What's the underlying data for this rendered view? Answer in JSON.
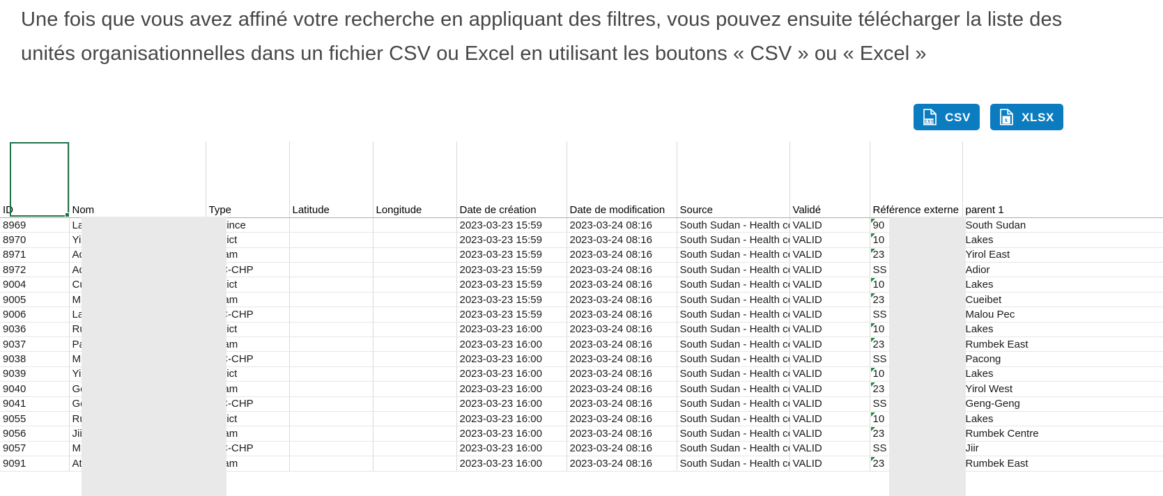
{
  "intro": {
    "text": "Une fois que vous avez affiné votre recherche en appliquant des filtres, vous pouvez ensuite télécharger la liste des unités organisationnelles dans un fichier CSV ou Excel en utilisant les boutons « CSV » ou « Excel »"
  },
  "toolbar": {
    "csv_label": "CSV",
    "xlsx_label": "XLSX",
    "csv_icon": "csv-file-icon",
    "xlsx_icon": "xlsx-file-icon",
    "button_color": "#0c7cc0",
    "button_text_color": "#ffffff"
  },
  "spreadsheet": {
    "active_cell_color": "#217346",
    "headers": [
      "ID",
      "Nom",
      "Type",
      "Latitude",
      "Longitude",
      "Date de création",
      "Date de modification",
      "Source",
      "Validé",
      "Référence externe",
      "parent 1"
    ],
    "rows": [
      {
        "id": "8969",
        "nom": "La",
        "type": "Province",
        "latitude": "",
        "longitude": "",
        "created": "2023-03-23 15:59",
        "modified": "2023-03-24 08:16",
        "source": "South Sudan - Health cen",
        "valide": "VALID",
        "ref": "90",
        "ref_error": true,
        "parent1": "South Sudan"
      },
      {
        "id": "8970",
        "nom": "Yi",
        "type": "District",
        "latitude": "",
        "longitude": "",
        "created": "2023-03-23 15:59",
        "modified": "2023-03-24 08:16",
        "source": "South Sudan - Health cen",
        "valide": "VALID",
        "ref": "10",
        "ref_error": true,
        "parent1": "Lakes"
      },
      {
        "id": "8971",
        "nom": "Ad",
        "type": "Payam",
        "latitude": "",
        "longitude": "",
        "created": "2023-03-23 15:59",
        "modified": "2023-03-24 08:16",
        "source": "South Sudan - Health cen",
        "valide": "VALID",
        "ref": "23",
        "ref_error": true,
        "parent1": "Yirol East"
      },
      {
        "id": "8972",
        "nom": "Ad",
        "type": "CHC-CHP",
        "latitude": "",
        "longitude": "",
        "created": "2023-03-23 15:59",
        "modified": "2023-03-24 08:16",
        "source": "South Sudan - Health cen",
        "valide": "VALID",
        "ref": "SS",
        "ref_error": false,
        "parent1": "Adior"
      },
      {
        "id": "9004",
        "nom": "Cu",
        "type": "District",
        "latitude": "",
        "longitude": "",
        "created": "2023-03-23 15:59",
        "modified": "2023-03-24 08:16",
        "source": "South Sudan - Health cen",
        "valide": "VALID",
        "ref": "10",
        "ref_error": true,
        "parent1": "Lakes"
      },
      {
        "id": "9005",
        "nom": "M",
        "type": "Payam",
        "latitude": "",
        "longitude": "",
        "created": "2023-03-23 15:59",
        "modified": "2023-03-24 08:16",
        "source": "South Sudan - Health cen",
        "valide": "VALID",
        "ref": "23",
        "ref_error": true,
        "parent1": "Cueibet"
      },
      {
        "id": "9006",
        "nom": "La",
        "type": "CHC-CHP",
        "latitude": "",
        "longitude": "",
        "created": "2023-03-23 15:59",
        "modified": "2023-03-24 08:16",
        "source": "South Sudan - Health cen",
        "valide": "VALID",
        "ref": "SS",
        "ref_error": false,
        "parent1": "Malou Pec"
      },
      {
        "id": "9036",
        "nom": "Ru",
        "type": "District",
        "latitude": "",
        "longitude": "",
        "created": "2023-03-23 16:00",
        "modified": "2023-03-24 08:16",
        "source": "South Sudan - Health cen",
        "valide": "VALID",
        "ref": "10",
        "ref_error": true,
        "parent1": "Lakes"
      },
      {
        "id": "9037",
        "nom": "Pa",
        "type": "Payam",
        "latitude": "",
        "longitude": "",
        "created": "2023-03-23 16:00",
        "modified": "2023-03-24 08:16",
        "source": "South Sudan - Health cen",
        "valide": "VALID",
        "ref": "23",
        "ref_error": true,
        "parent1": "Rumbek East"
      },
      {
        "id": "9038",
        "nom": "M",
        "type": "CHC-CHP",
        "latitude": "",
        "longitude": "",
        "created": "2023-03-23 16:00",
        "modified": "2023-03-24 08:16",
        "source": "South Sudan - Health cen",
        "valide": "VALID",
        "ref": "SS",
        "ref_error": false,
        "parent1": "Pacong"
      },
      {
        "id": "9039",
        "nom": "Yi",
        "type": "District",
        "latitude": "",
        "longitude": "",
        "created": "2023-03-23 16:00",
        "modified": "2023-03-24 08:16",
        "source": "South Sudan - Health cen",
        "valide": "VALID",
        "ref": "10",
        "ref_error": true,
        "parent1": "Lakes"
      },
      {
        "id": "9040",
        "nom": "Ge",
        "type": "Payam",
        "latitude": "",
        "longitude": "",
        "created": "2023-03-23 16:00",
        "modified": "2023-03-24 08:16",
        "source": "South Sudan - Health cen",
        "valide": "VALID",
        "ref": "23",
        "ref_error": true,
        "parent1": "Yirol West"
      },
      {
        "id": "9041",
        "nom": "Ge",
        "type": "CHC-CHP",
        "latitude": "",
        "longitude": "",
        "created": "2023-03-23 16:00",
        "modified": "2023-03-24 08:16",
        "source": "South Sudan - Health cen",
        "valide": "VALID",
        "ref": "SS",
        "ref_error": false,
        "parent1": "Geng-Geng"
      },
      {
        "id": "9055",
        "nom": "Ru",
        "type": "District",
        "latitude": "",
        "longitude": "",
        "created": "2023-03-23 16:00",
        "modified": "2023-03-24 08:16",
        "source": "South Sudan - Health cen",
        "valide": "VALID",
        "ref": "10",
        "ref_error": true,
        "parent1": "Lakes"
      },
      {
        "id": "9056",
        "nom": "Jii",
        "type": "Payam",
        "latitude": "",
        "longitude": "",
        "created": "2023-03-23 16:00",
        "modified": "2023-03-24 08:16",
        "source": "South Sudan - Health cen",
        "valide": "VALID",
        "ref": "23",
        "ref_error": true,
        "parent1": "Rumbek Centre"
      },
      {
        "id": "9057",
        "nom": "M",
        "type": "CHC-CHP",
        "latitude": "",
        "longitude": "",
        "created": "2023-03-23 16:00",
        "modified": "2023-03-24 08:16",
        "source": "South Sudan - Health cen",
        "valide": "VALID",
        "ref": "SS",
        "ref_error": false,
        "parent1": "Jiir"
      },
      {
        "id": "9091",
        "nom": "At",
        "type": "Payam",
        "latitude": "",
        "longitude": "",
        "created": "2023-03-23 16:00",
        "modified": "2023-03-24 08:16",
        "source": "South Sudan - Health cen",
        "valide": "VALID",
        "ref": "23",
        "ref_error": true,
        "parent1": "Rumbek East"
      }
    ]
  }
}
